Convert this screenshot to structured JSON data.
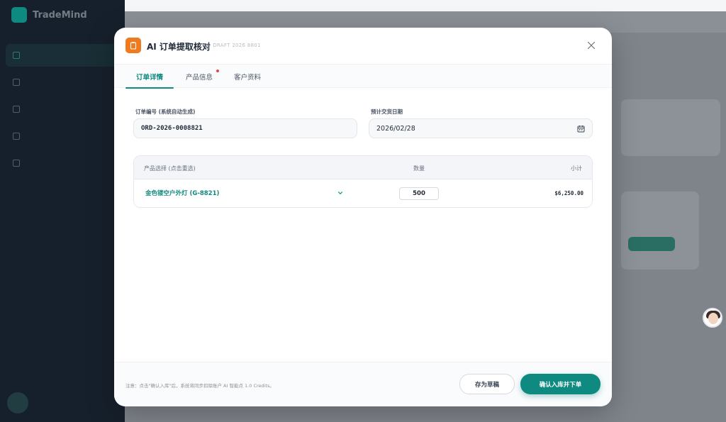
{
  "app": {
    "brand": "TradeMind"
  },
  "modal": {
    "title": "AI 订单提取核对",
    "draft_id": "ID: DRAFT 2026 8801",
    "tabs": [
      {
        "label": "订单详情",
        "active": true
      },
      {
        "label": "产品信息",
        "active": false,
        "has_alert": true
      },
      {
        "label": "客户资料",
        "active": false
      }
    ],
    "fields": {
      "order_no_label": "订单编号 (系统自动生成)",
      "order_no_value": "ORD-2026-0008821",
      "delivery_label": "预计交货日期",
      "delivery_value": "2026/02/28"
    },
    "table": {
      "headers": {
        "product": "产品选择 (点击重选)",
        "quantity": "数量",
        "subtotal": "小计"
      },
      "rows": [
        {
          "product": "金色镂空户外灯 (G-8821)",
          "quantity": "500",
          "subtotal": "$6,250.00"
        }
      ]
    },
    "footer": {
      "note": "注意：点击\"确认入库\"后，系统将同步扣除账户 AI 智能点 1.0 Credits。",
      "draft_button": "存为草稿",
      "confirm_button": "确认入库并下单"
    }
  },
  "colors": {
    "accent": "#0f8a80",
    "header_icon": "#f07b1e",
    "alert_dot": "#ef4444"
  }
}
